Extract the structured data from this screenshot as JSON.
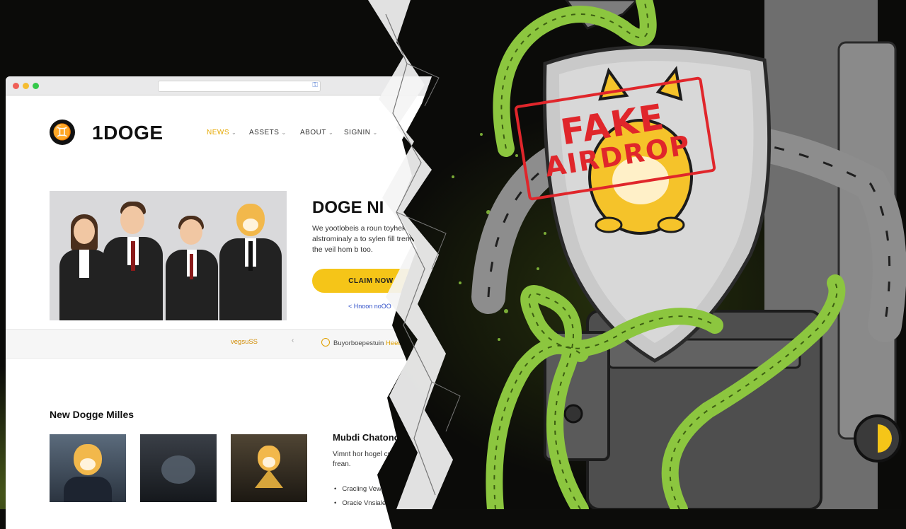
{
  "browser": {
    "url": ""
  },
  "site": {
    "logo_glyph": "♊",
    "brand": "1DOGE",
    "nav": [
      {
        "label": "NEWS",
        "active": true
      },
      {
        "label": "ASSETS",
        "active": false
      },
      {
        "label": "ABOUT",
        "active": false
      },
      {
        "label": "SIGNIN",
        "active": false
      }
    ]
  },
  "hero": {
    "title": "DOGE NI",
    "text": "We yootlobeis a roun toyheke in alstrominaly a to sylen fill trem the tor the veil hom b too.",
    "cta_label": "CLAIM NOW",
    "cta_arrow": "→",
    "sublink": "< Hnoon noOO"
  },
  "strip": {
    "left_text": "vegsuSS",
    "sep": "‹",
    "right_text": "Buyorboepestuin",
    "right_highlight": "Heed"
  },
  "lower": {
    "section_title": "New Dogge Milles",
    "side_title": "Mubdi Chatonodrites",
    "side_text": "Vimnt hor hogel cmpletcch ed an diyage frean.",
    "side_items": [
      "Cracling Vewpelic",
      "Oracie Vnsialec"
    ]
  },
  "stamp": {
    "line1": "FAKE",
    "line2": "AIRDROP",
    "color": "#e0262b"
  },
  "colors": {
    "accent": "#f5c518",
    "tentacle": "#8cc63f",
    "metal": "#9a9a9a"
  }
}
